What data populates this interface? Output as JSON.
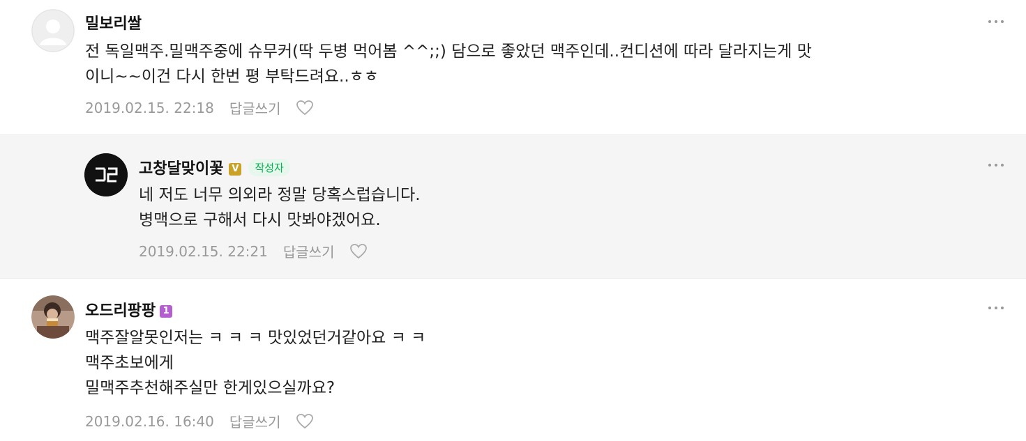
{
  "comments": [
    {
      "nickname": "밀보리쌀",
      "text_lines": [
        "전 독일맥주.밀맥주중에 슈무커(딱 두병 먹어봄 ^^;;) 담으로 좋았던 맥주인데..컨디션에 따라 달라지는게 맛",
        "이니~~이건 다시 한번 평 부탁드려요..ㅎㅎ"
      ],
      "date": "2019.02.15. 22:18",
      "reply_label": "답글쓰기"
    },
    {
      "nickname": "고창달맞이꽃",
      "verified_badge": "V",
      "author_badge": "작성자",
      "avatar_text": "고달",
      "text_lines": [
        "네 저도 너무 의외라 정말 당혹스럽습니다.",
        "병맥으로 구해서 다시 맛봐야겠어요."
      ],
      "date": "2019.02.15. 22:21",
      "reply_label": "답글쓰기"
    },
    {
      "nickname": "오드리팡팡",
      "level_badge": "1",
      "text_lines": [
        "맥주잘알못인저는 ㅋ ㅋ ㅋ 맛있었던거같아요 ㅋ ㅋ",
        "맥주초보에게",
        "밀맥주추천해주실만 한게있으실까요?"
      ],
      "date": "2019.02.16. 16:40",
      "reply_label": "답글쓰기"
    }
  ],
  "colors": {
    "reply_bg": "#f5f5f5",
    "author_badge_text": "#03b34f",
    "verified_badge": "#c9a227",
    "level_badge": "#b45fd0",
    "meta_text": "#999999"
  },
  "icons": [
    "default-avatar-icon",
    "heart-icon",
    "more-options-icon"
  ]
}
